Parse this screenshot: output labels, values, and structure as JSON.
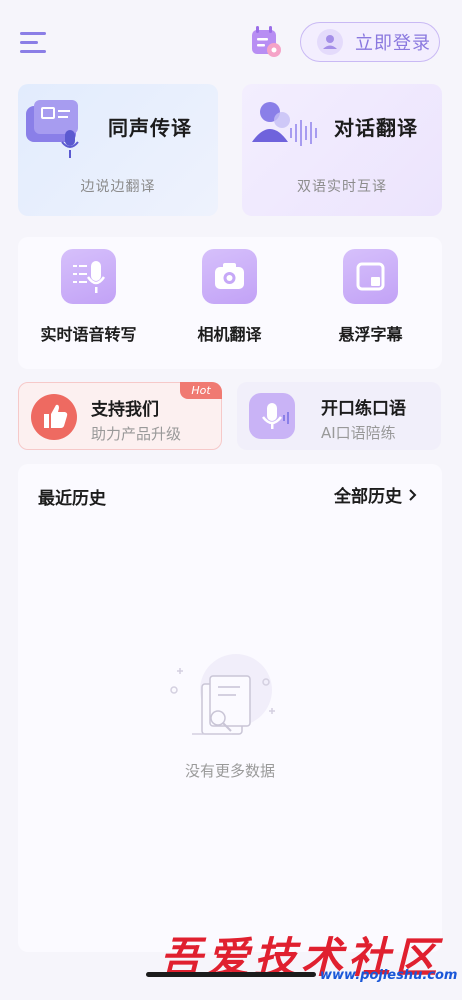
{
  "header": {
    "menu_icon": "hamburger-menu-icon",
    "calendar_icon": "calendar-settings-icon",
    "login_label": "立即登录",
    "avatar_icon": "user-avatar-icon"
  },
  "top_cards": [
    {
      "title": "同声传译",
      "subtitle": "边说边翻译",
      "icon": "presentation-microphone-icon"
    },
    {
      "title": "对话翻译",
      "subtitle": "双语实时互译",
      "icon": "speaker-voice-wave-icon"
    }
  ],
  "tools": [
    {
      "label": "实时语音转写",
      "icon": "voice-transcribe-icon"
    },
    {
      "label": "相机翻译",
      "icon": "camera-icon"
    },
    {
      "label": "悬浮字幕",
      "icon": "floating-window-icon"
    }
  ],
  "promos": [
    {
      "title": "支持我们",
      "subtitle": "助力产品升级",
      "badge": "Hot",
      "icon": "thumbs-up-icon"
    },
    {
      "title": "开口练口语",
      "subtitle": "AI口语陪练",
      "icon": "microphone-icon"
    }
  ],
  "history": {
    "title": "最近历史",
    "all_label": "全部历史",
    "empty_text": "没有更多数据",
    "empty_icon": "empty-documents-search-icon"
  },
  "watermark": {
    "text": "吾爱技术社区",
    "url": "www.pojieshu.com"
  },
  "colors": {
    "accent": "#8a78df",
    "tool_icon_bg": "#c8aaf7",
    "hot": "#f07a72"
  }
}
